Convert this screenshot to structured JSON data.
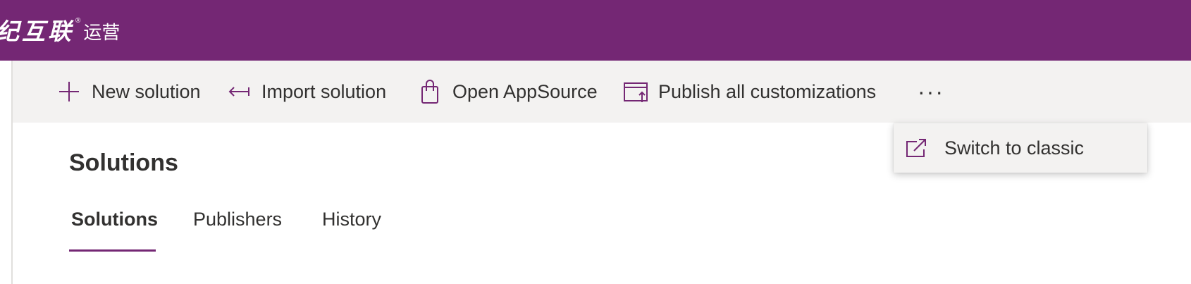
{
  "brand": {
    "name_cn": "纪互联",
    "registered_mark": "®",
    "sub_cn": "运营"
  },
  "toolbar": {
    "new_solution": {
      "label": "New solution",
      "icon": "plus-icon"
    },
    "import_solution": {
      "label": "Import solution",
      "icon": "import-arrow-icon"
    },
    "open_appsource": {
      "label": "Open AppSource",
      "icon": "shopping-bag-icon"
    },
    "publish_all": {
      "label": "Publish all customizations",
      "icon": "publish-icon"
    },
    "more": {
      "label": "···",
      "icon": "more-icon"
    }
  },
  "overflow_menu": {
    "items": [
      {
        "label": "Switch to classic",
        "icon": "open-external-icon"
      }
    ]
  },
  "page": {
    "title": "Solutions"
  },
  "tabs": [
    {
      "label": "Solutions",
      "active": true
    },
    {
      "label": "Publishers",
      "active": false
    },
    {
      "label": "History",
      "active": false
    }
  ],
  "colors": {
    "brand": "#742774",
    "command_bar_bg": "#f3f2f1",
    "text": "#323130"
  }
}
